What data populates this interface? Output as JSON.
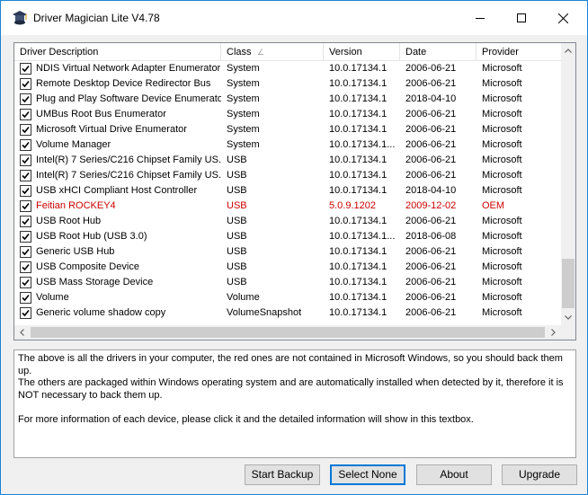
{
  "window": {
    "title": "Driver Magician Lite V4.78"
  },
  "colors": {
    "window_border": "#1883d7",
    "missing_driver": "#cc0000",
    "default_button": "#0078d7"
  },
  "table": {
    "columns": [
      "Driver Description",
      "Class",
      "Version",
      "Date",
      "Provider"
    ],
    "sort_indicator": "∠",
    "rows": [
      {
        "desc": "NDIS Virtual Network Adapter Enumerator",
        "cls": "System",
        "ver": "10.0.17134.1",
        "date": "2006-06-21",
        "prov": "Microsoft",
        "missing": false
      },
      {
        "desc": "Remote Desktop Device Redirector Bus",
        "cls": "System",
        "ver": "10.0.17134.1",
        "date": "2006-06-21",
        "prov": "Microsoft",
        "missing": false
      },
      {
        "desc": "Plug and Play Software Device Enumerator",
        "cls": "System",
        "ver": "10.0.17134.1",
        "date": "2018-04-10",
        "prov": "Microsoft",
        "missing": false
      },
      {
        "desc": "UMBus Root Bus Enumerator",
        "cls": "System",
        "ver": "10.0.17134.1",
        "date": "2006-06-21",
        "prov": "Microsoft",
        "missing": false
      },
      {
        "desc": "Microsoft Virtual Drive Enumerator",
        "cls": "System",
        "ver": "10.0.17134.1",
        "date": "2006-06-21",
        "prov": "Microsoft",
        "missing": false
      },
      {
        "desc": "Volume Manager",
        "cls": "System",
        "ver": "10.0.17134.1...",
        "date": "2006-06-21",
        "prov": "Microsoft",
        "missing": false
      },
      {
        "desc": "Intel(R) 7 Series/C216 Chipset Family US...",
        "cls": "USB",
        "ver": "10.0.17134.1",
        "date": "2006-06-21",
        "prov": "Microsoft",
        "missing": false
      },
      {
        "desc": "Intel(R) 7 Series/C216 Chipset Family US...",
        "cls": "USB",
        "ver": "10.0.17134.1",
        "date": "2006-06-21",
        "prov": "Microsoft",
        "missing": false
      },
      {
        "desc": "USB xHCI Compliant Host Controller",
        "cls": "USB",
        "ver": "10.0.17134.1",
        "date": "2018-04-10",
        "prov": "Microsoft",
        "missing": false
      },
      {
        "desc": "Feitian ROCKEY4",
        "cls": "USB",
        "ver": "5.0.9.1202",
        "date": "2009-12-02",
        "prov": "OEM",
        "missing": true
      },
      {
        "desc": "USB Root Hub",
        "cls": "USB",
        "ver": "10.0.17134.1",
        "date": "2006-06-21",
        "prov": "Microsoft",
        "missing": false
      },
      {
        "desc": "USB Root Hub (USB 3.0)",
        "cls": "USB",
        "ver": "10.0.17134.1...",
        "date": "2018-06-08",
        "prov": "Microsoft",
        "missing": false
      },
      {
        "desc": "Generic USB Hub",
        "cls": "USB",
        "ver": "10.0.17134.1",
        "date": "2006-06-21",
        "prov": "Microsoft",
        "missing": false
      },
      {
        "desc": "USB Composite Device",
        "cls": "USB",
        "ver": "10.0.17134.1",
        "date": "2006-06-21",
        "prov": "Microsoft",
        "missing": false
      },
      {
        "desc": "USB Mass Storage Device",
        "cls": "USB",
        "ver": "10.0.17134.1",
        "date": "2006-06-21",
        "prov": "Microsoft",
        "missing": false
      },
      {
        "desc": "Volume",
        "cls": "Volume",
        "ver": "10.0.17134.1",
        "date": "2006-06-21",
        "prov": "Microsoft",
        "missing": false
      },
      {
        "desc": "Generic volume shadow copy",
        "cls": "VolumeSnapshot",
        "ver": "10.0.17134.1",
        "date": "2006-06-21",
        "prov": "Microsoft",
        "missing": false
      }
    ]
  },
  "info": {
    "text": "The above is all the drivers in your computer, the red ones are not contained in Microsoft Windows, so you should back them up.\nThe others are packaged within Windows operating system and are automatically installed when detected by it, therefore it is NOT necessary to back them up.\n\nFor more information of each device, please click it and the detailed information will show in this textbox."
  },
  "buttons": {
    "start_backup": "Start Backup",
    "select_none": "Select None",
    "about": "About",
    "upgrade": "Upgrade"
  }
}
